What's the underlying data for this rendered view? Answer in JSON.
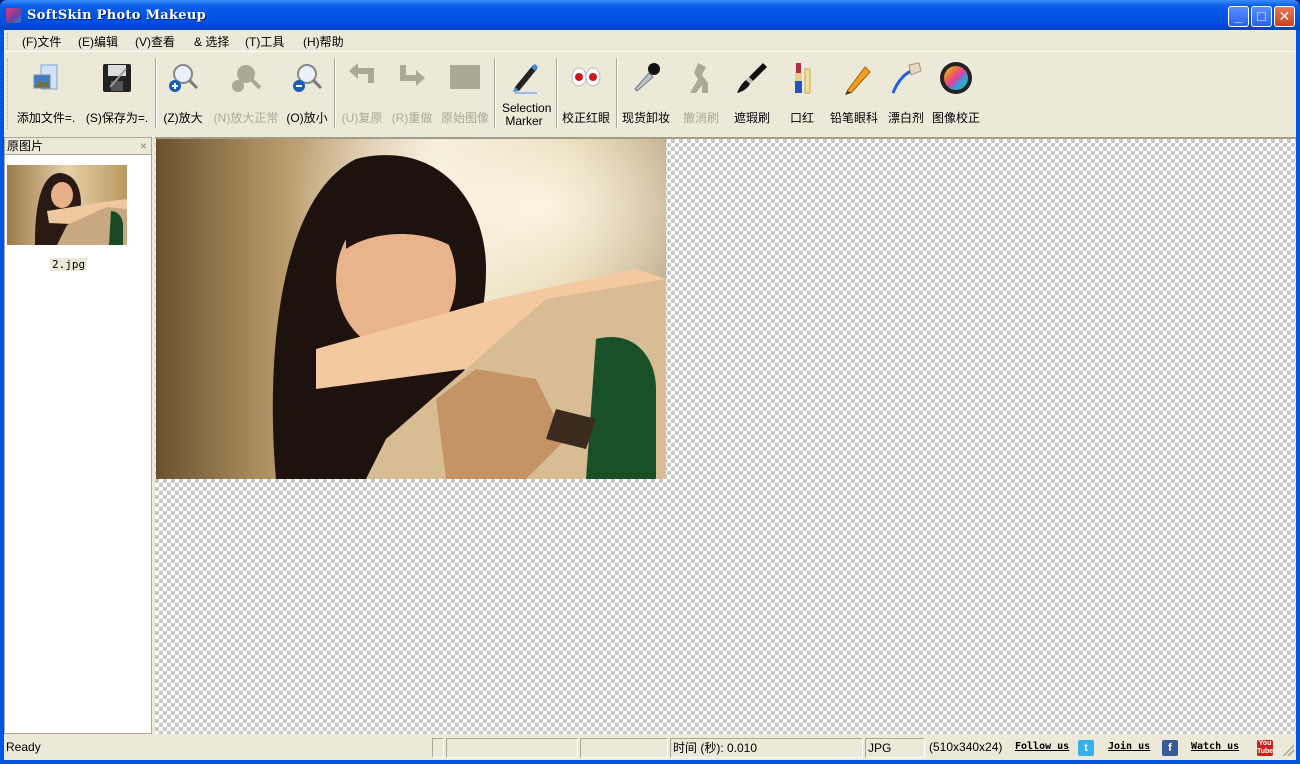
{
  "window": {
    "title": "SoftSkin Photo Makeup",
    "minimize": "_",
    "maximize": "□",
    "close": "✕"
  },
  "menu": [
    "(F)文件",
    "(E)编辑",
    "(V)查看",
    "& 选择",
    "(T)工具",
    "(H)帮助"
  ],
  "toolbar": [
    {
      "label": "添加文件=.",
      "icon": "add-file-icon",
      "enabled": true
    },
    {
      "label": "(S)保存为=.",
      "icon": "save-icon",
      "enabled": true
    },
    {
      "label": "(Z)放大",
      "icon": "zoom-in-icon",
      "enabled": true
    },
    {
      "label": "(N)放大正常",
      "icon": "zoom-normal-icon",
      "enabled": false
    },
    {
      "label": "(O)放小",
      "icon": "zoom-out-icon",
      "enabled": true
    },
    {
      "label": "(U)复原",
      "icon": "undo-icon",
      "enabled": false
    },
    {
      "label": "(R)重做",
      "icon": "redo-icon",
      "enabled": false
    },
    {
      "label": "原始图像",
      "icon": "original-image-icon",
      "enabled": false
    },
    {
      "label": "Selection Marker",
      "icon": "marker-icon",
      "enabled": true
    },
    {
      "label": "校正红眼",
      "icon": "red-eye-icon",
      "enabled": true
    },
    {
      "label": "现货卸妆",
      "icon": "dropper-icon",
      "enabled": true
    },
    {
      "label": "撤消刷",
      "icon": "undo-brush-icon",
      "enabled": false
    },
    {
      "label": "遮瑕刷",
      "icon": "brush-icon",
      "enabled": true
    },
    {
      "label": "口红",
      "icon": "lipstick-icon",
      "enabled": true
    },
    {
      "label": "铅笔眼科",
      "icon": "pencil-icon",
      "enabled": true
    },
    {
      "label": "漂白剂",
      "icon": "toothbrush-icon",
      "enabled": true
    },
    {
      "label": "图像校正",
      "icon": "color-wheel-icon",
      "enabled": true
    }
  ],
  "panel": {
    "title": "原图片",
    "close": "×",
    "files": [
      {
        "name": "2.jpg"
      }
    ]
  },
  "status": {
    "ready": "Ready",
    "time": "时间 (秒): 0.010",
    "format": "JPG",
    "dims": "(510x340x24)",
    "follow": "Follow us",
    "join": "Join us",
    "watch": "Watch us"
  }
}
